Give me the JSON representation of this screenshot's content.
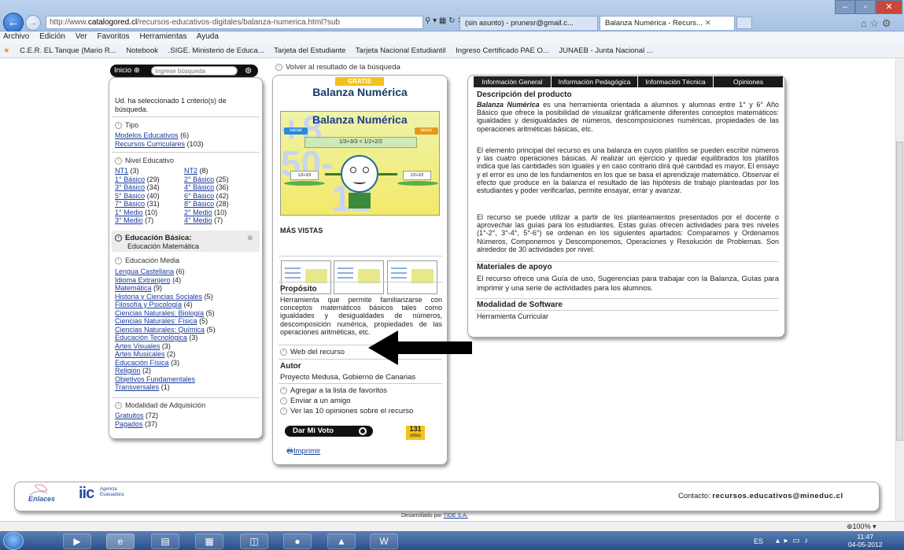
{
  "browser": {
    "url_prefix": "http://www.",
    "url_domain": "catalogored.cl",
    "url_rest": "/recursos-educativos-digitales/balanza-numerica.html?sub",
    "tabs": [
      {
        "label": "(sin asunto) - prunesr@gmail.c..."
      },
      {
        "label": "Balanza Numérica - Recurs..."
      }
    ],
    "menu": [
      "Archivo",
      "Edición",
      "Ver",
      "Favoritos",
      "Herramientas",
      "Ayuda"
    ],
    "favorites": [
      "C.E.R. EL Tanque (Mario R...",
      "Notebook",
      ".SIGE. Ministerio de Educa...",
      "Tarjeta del Estudiante",
      "Tarjeta Nacional Estudiantil",
      "Ingreso Certificado PAE O...",
      "JUNAEB - Junta Nacional ..."
    ],
    "zoom": "100%"
  },
  "topbar": {
    "home_label": "Inicio",
    "search_placeholder": "Ingrese búsqueda",
    "back_link": "Volver al resultado de la búsqueda"
  },
  "sidebar": {
    "selected_text": "Ud. ha seleccionado 1 criterio(s) de búsqueda.",
    "tipo_header": "Tipo",
    "tipo_items": [
      {
        "label": "Modelos Educativos",
        "count": "(6)"
      },
      {
        "label": "Recursos Curriculares",
        "count": "(103)"
      }
    ],
    "nivel_header": "Nivel Educativo",
    "nivel_left": [
      {
        "label": "NT1",
        "count": "(3)"
      },
      {
        "label": "1° Básico",
        "count": "(29)"
      },
      {
        "label": "3° Básico",
        "count": "(34)"
      },
      {
        "label": "5° Básico",
        "count": "(40)"
      },
      {
        "label": "7° Básico",
        "count": "(31)"
      },
      {
        "label": "1° Medio",
        "count": "(10)"
      },
      {
        "label": "3° Medio",
        "count": "(7)"
      }
    ],
    "nivel_right": [
      {
        "label": "NT2",
        "count": "(8)"
      },
      {
        "label": "2° Básico",
        "count": "(25)"
      },
      {
        "label": "4° Básico",
        "count": "(36)"
      },
      {
        "label": "6° Básico",
        "count": "(42)"
      },
      {
        "label": "8° Básico",
        "count": "(28)"
      },
      {
        "label": "2° Medio",
        "count": "(10)"
      },
      {
        "label": "4° Medio",
        "count": "(7)"
      }
    ],
    "basica_title": "Educación Básica:",
    "basica_sub": "Educación Matemática",
    "media_header": "Educación Media",
    "media_items": [
      {
        "label": "Lengua Castellana",
        "count": "(6)"
      },
      {
        "label": "Idioma Extranjero",
        "count": "(4)"
      },
      {
        "label": "Matemática",
        "count": "(9)"
      },
      {
        "label": "Historia y Ciencias Sociales",
        "count": "(5)"
      },
      {
        "label": "Filosofía y Psicología",
        "count": "(4)"
      },
      {
        "label": "Ciencias Naturales: Biología",
        "count": "(5)"
      },
      {
        "label": "Ciencias Naturales: Física",
        "count": "(5)"
      },
      {
        "label": "Ciencias Naturales: Química",
        "count": "(5)"
      },
      {
        "label": "Educación Tecnológica",
        "count": "(3)"
      },
      {
        "label": "Artes Visuales",
        "count": "(3)"
      },
      {
        "label": "Artes Musicales",
        "count": "(2)"
      },
      {
        "label": "Educación Física",
        "count": "(3)"
      },
      {
        "label": "Religión",
        "count": "(2)"
      },
      {
        "label": "Objetivos Fundamentales Transversales",
        "count": "(1)"
      }
    ],
    "modalidad_header": "Modalidad de Adquisición",
    "modalidad_items": [
      {
        "label": "Gratuitos",
        "count": "(72)"
      },
      {
        "label": "Pagados",
        "count": "(37)"
      }
    ]
  },
  "product": {
    "badge": "GRATIS",
    "title": "Balanza Numérica",
    "game_title": "Balanza Numérica",
    "game_btn_left": "vaciar",
    "game_btn_right": "pesar",
    "game_equation": "1/3+3/3 < 1/2+2/2",
    "game_pan_left": "1/3+3/3",
    "game_pan_right": "1/2+2/2",
    "mas_vistas": "MÁS VISTAS",
    "proposito_title": "Propósito",
    "proposito_text": "Herramienta que permite familiarizarse con conceptos matemáticos básicos tales como igualdades y desigualdades de números, descomposición numérica, propiedades de las operaciones aritméticas, etc.",
    "web_link": "Web del recurso",
    "autor_title": "Autor",
    "autor_text": "Proyecto Medusa, Gobierno de Canarias",
    "actions": [
      "Agregar a la lista de favoritos",
      "Enviar a un amigo",
      "Ver las 10 opiniones sobre el recurso"
    ],
    "vote_label": "Dar Mi Voto",
    "votes_count": "131",
    "votes_word": "votos",
    "print_label": "Imprimir"
  },
  "info": {
    "tabs": [
      "Información General",
      "Información Pedagógica",
      "Información Técnica",
      "Opiniones"
    ],
    "desc_title": "Descripción del producto",
    "desc_p1_bold": "Balanza Numérica",
    "desc_p1": " es una herramienta orientada a alumnos y alumnas entre 1° y 6° Año Básico que ofrece la posibilidad de visualizar gráficamente diferentes conceptos matemáticos: igualdades y desigualdades de números, descomposiciones numéricas, propiedades de las operaciones aritméticas básicas, etc.",
    "desc_p2": "El elemento principal del recurso es una balanza en cuyos platillos se pueden escribir números y las cuatro operaciones básicas. Al realizar un ejercicio y quedar equilibrados los platillos indica que las cantidades son iguales y en caso contrario dirá qué cantidad es mayor. El ensayo y el error es uno de los fundamentos en los que se basa el aprendizaje matemático. Observar el efecto que produce en la balanza el resultado de las hipótesis de trabajo planteadas por los estudiantes y poder verificarlas, permite ensayar, errar y avanzar.",
    "desc_p3": "El recurso se puede utilizar a partir de los planteamientos presentados por el docente o aprovechar las guías para los estudiantes. Estas guías ofrecen actividades para tres niveles (1°-2°, 3°-4°, 5°-6°) se ordenan en los siguientes apartados: Comparamos y Ordenamos Números, Componemos y Descomponemos, Operaciones y Resolución de Problemas. Son alrededor de 30 actividades por nivel.",
    "materiales_title": "Materiales de apoyo",
    "materiales_text": "El recurso ofrece una Guía de uso, Sugerencias para trabajar con la Balanza, Guías para imprimir y una serie de actividades para los alumnos.",
    "modalidad_title": "Modalidad de Software",
    "modalidad_text": "Herramienta Curricular"
  },
  "footer": {
    "enlaces": "Enlaces",
    "agencia_line1": "Agencia",
    "agencia_line2": "Evaluadora",
    "contact_label": "Contacto:",
    "contact_email": "recursos.educativos@mineduc.cl",
    "developed_by": "Desarrollado por",
    "developer": "TIDE S.A."
  },
  "taskbar": {
    "lang": "ES",
    "time": "11:47",
    "date": "04-05-2012"
  }
}
